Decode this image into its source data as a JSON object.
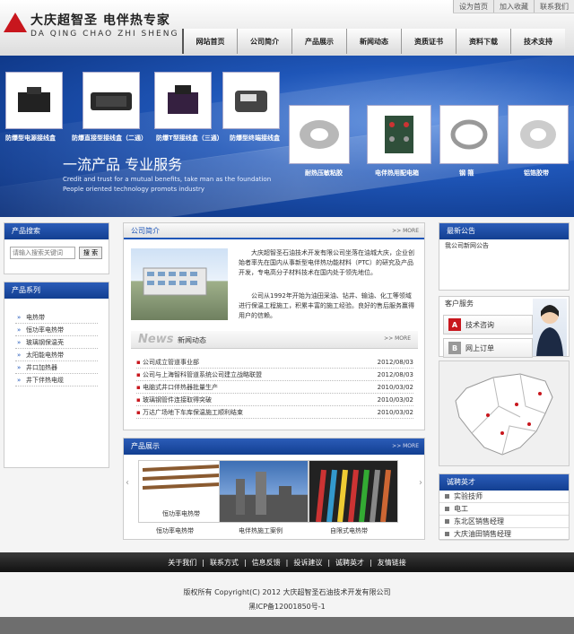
{
  "header": {
    "logo_cn": "大庆超智圣 电伴热专家",
    "logo_en": "DA QING CHAO ZHI SHENG",
    "top_links": [
      "设为首页",
      "加入收藏",
      "联系我们"
    ],
    "nav": [
      "网站首页",
      "公司简介",
      "产品展示",
      "新闻动态",
      "资质证书",
      "资料下载",
      "技术支持"
    ]
  },
  "banner": {
    "top_products": [
      "防爆型电源接线盒",
      "防爆直接型接线盒（二通）",
      "防爆T型接线盒（三通）",
      "防爆型终端接线盒"
    ],
    "bottom_products": [
      "耐热压敏粘胶",
      "电伴热用配电箱",
      "钢 箍",
      "铝箔胶带"
    ],
    "slogan": "一流产品 专业服务",
    "slogan_en1": "Credit and trust for a mutual benefits, take man as the foundation",
    "slogan_en2": "People oriented technology promots industry"
  },
  "search": {
    "title": "产品搜索",
    "placeholder": "请输入搜索关键词",
    "button": "搜 索"
  },
  "series": {
    "title": "产品系列",
    "items": [
      "电热带",
      "恒功率电热带",
      "玻璃钢保温壳",
      "太阳能电热带",
      "井口加热器",
      "井下伴热电缆"
    ]
  },
  "about": {
    "title": "公司简介",
    "more": ">> MORE",
    "para1": "大庆超智圣石油技术开发有限公司坐落在油城大庆，企业创始者率先在国内从事新型电伴热功能材料（PTC）的研究及产品开发，专电高分子材料技术在国内处于领先地位。",
    "para2": "公司从1992年开始为油田采油、钻井、输油、化工等领域进行保温工程施工，积累丰富的施工经验。良好的售后服务赢得用户的信赖。"
  },
  "news": {
    "logo": "News",
    "title": "新闻动态",
    "more": ">> MORE",
    "items": [
      {
        "text": "公司成立管道事业部",
        "date": "2012/08/03"
      },
      {
        "text": "公司与上海智科管道系统公司建立战略联盟",
        "date": "2012/08/03"
      },
      {
        "text": "电脑式井口伴热器批量生产",
        "date": "2010/03/02"
      },
      {
        "text": "玻璃钢管件连接取得突破",
        "date": "2010/03/02"
      },
      {
        "text": "万达广场地下车库保温施工顺利结束",
        "date": "2010/03/02"
      }
    ]
  },
  "products": {
    "title": "产品展示",
    "more": ">> MORE",
    "items": [
      {
        "inner": "恒功率电热带",
        "caption": "恒功率电热带"
      },
      {
        "inner": "",
        "caption": "电伴热施工案例"
      },
      {
        "inner": "",
        "caption": "自限式电热带"
      }
    ]
  },
  "notice": {
    "title": "最新公告",
    "text": "我公司新网公告"
  },
  "service": {
    "title": "客户服务",
    "items": [
      {
        "icon": "A",
        "label": "技术咨询",
        "color": "#c8161d"
      },
      {
        "icon": "B",
        "label": "网上订单",
        "color": "#999999"
      }
    ]
  },
  "jobs": {
    "title": "诚聘英才",
    "items": [
      "实验技师",
      "电工",
      "东北区销售经理",
      "大庆油田销售经理"
    ]
  },
  "footer": {
    "links": [
      "关于我们",
      "联系方式",
      "信息反馈",
      "投诉建议",
      "诚聘英才",
      "友情链接"
    ],
    "copyright": "版权所有 Copyright(C) 2012 大庆超智圣石油技术开发有限公司",
    "icp": "黑ICP备12001850号-1"
  },
  "colors": {
    "brand_red": "#c8161d",
    "nav_blue": "#1f56b8"
  }
}
